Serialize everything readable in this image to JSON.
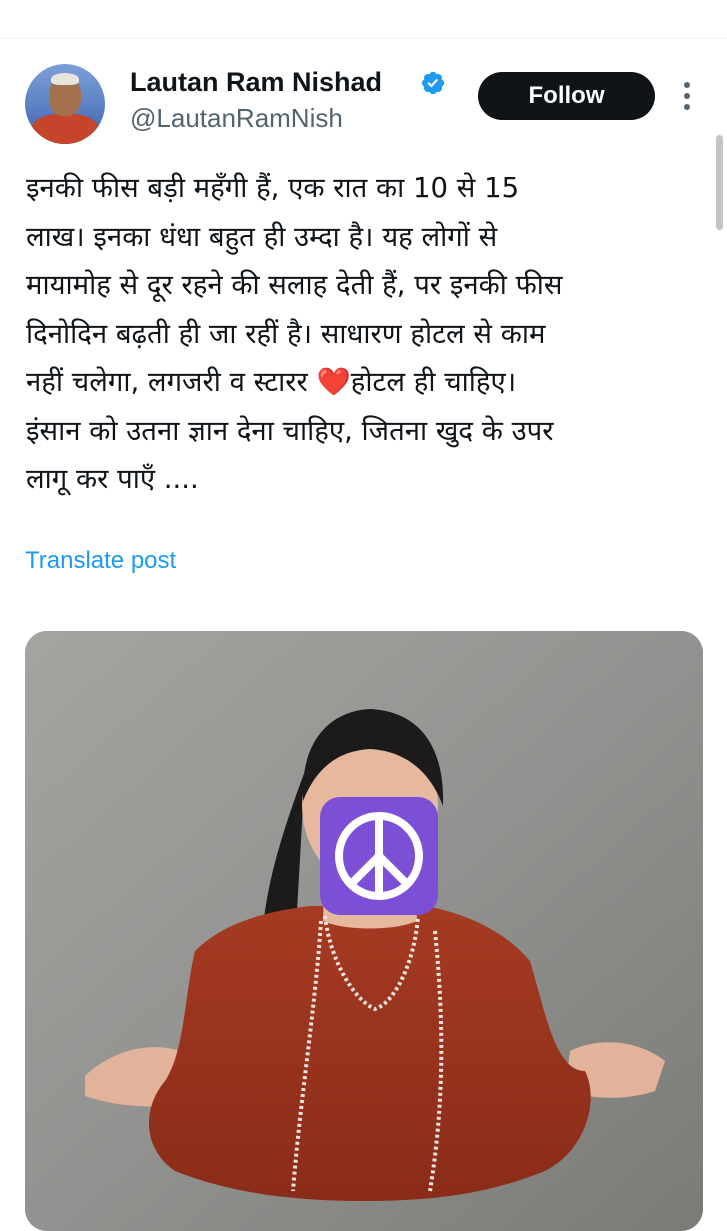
{
  "post": {
    "author": {
      "display_name": "Lautan Ram Nishad",
      "handle": "@LautanRamNish",
      "verified": true
    },
    "follow_label": "Follow",
    "text_lines": [
      "इनकी फीस बड़ी महँगी हैं, एक रात का 10 से 15",
      "लाख। इनका धंधा बहुत ही उम्दा है। यह लोगों से",
      "मायामोह से दूर रहने की सलाह देती हैं, पर इनकी फीस",
      "दिनोदिन बढ़ती ही जा रहीं है। साधारण होटल से काम",
      "नहीं चलेगा, लगजरी व स्टारर ",
      "होटल ही चाहिए।",
      "इंसान को उतना ज्ञान देना चाहिए, जितना खुद के उपर",
      "लागू कर पाएँ ...."
    ],
    "heart_emoji": "❤️",
    "translate_label": "Translate post",
    "media": {
      "emoji": "☮",
      "emoji_color": "#7b4fd6"
    }
  },
  "colors": {
    "link": "#1d9bf0",
    "verified": "#1d9bf0",
    "follow_bg": "#0f1419",
    "secondary_text": "#536471"
  }
}
